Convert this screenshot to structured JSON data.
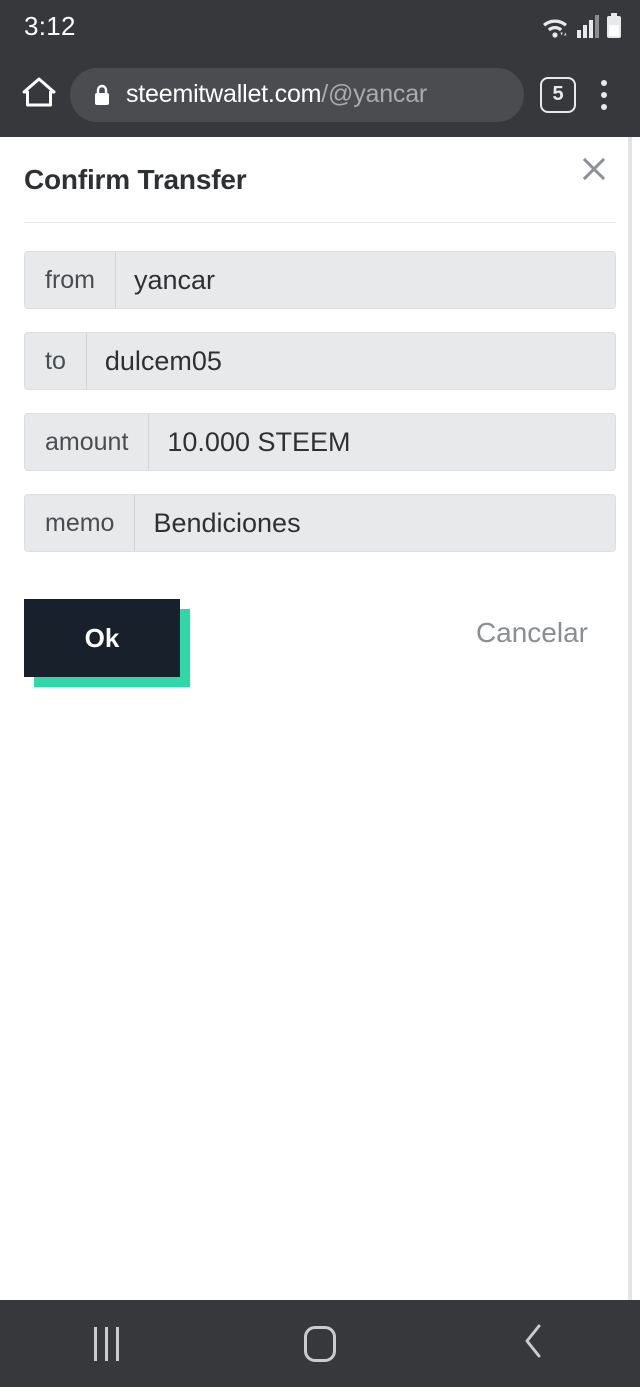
{
  "status_bar": {
    "time": "3:12",
    "icons": [
      "wifi-icon",
      "cellular-signal-icon",
      "battery-icon"
    ]
  },
  "browser": {
    "home_icon": "home-icon",
    "lock_icon": "lock-icon",
    "url_domain": "steemitwallet.com",
    "url_path": "/@yancar",
    "tab_count": "5",
    "menu_icon": "overflow-menu-icon"
  },
  "dialog": {
    "title": "Confirm Transfer",
    "close_icon": "close-icon",
    "fields": [
      {
        "label": "from",
        "value": "yancar"
      },
      {
        "label": "to",
        "value": "dulcem05"
      },
      {
        "label": "amount",
        "value": "10.000 STEEM"
      },
      {
        "label": "memo",
        "value": "Bendiciones"
      }
    ],
    "ok_label": "Ok",
    "cancel_label": "Cancelar"
  },
  "colors": {
    "accent_teal": "#2ed8a7",
    "button_dark": "#17202b",
    "chrome_dark": "#37383c",
    "field_gray": "#e8e9eb"
  },
  "nav_bar": {
    "recents_icon": "recents-icon",
    "home_icon": "home-square-icon",
    "back_icon": "back-chevron-icon"
  }
}
